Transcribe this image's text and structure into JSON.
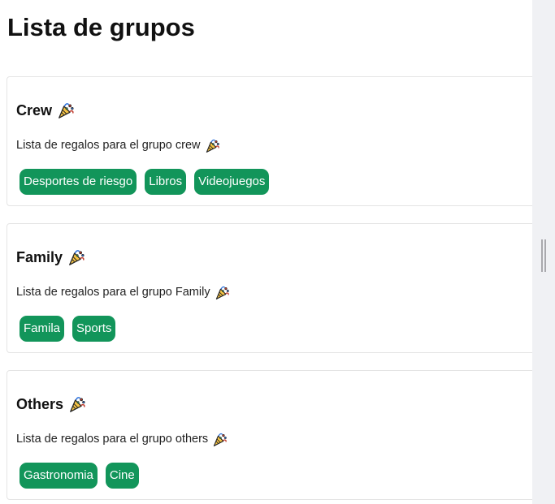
{
  "page": {
    "title": "Lista de grupos"
  },
  "groups": [
    {
      "name": "Crew",
      "description": "Lista de regalos para el grupo crew",
      "tags": [
        "Desportes de riesgo",
        "Libros",
        "Videojuegos"
      ]
    },
    {
      "name": "Family",
      "description": "Lista de regalos para el grupo Family",
      "tags": [
        "Famila",
        "Sports"
      ]
    },
    {
      "name": "Others",
      "description": "Lista de regalos para el grupo others",
      "tags": [
        "Gastronomia",
        "Cine"
      ]
    }
  ],
  "icons": {
    "title_emoji": "party-popper-icon",
    "description_emoji": "party-popper-icon",
    "scrollbar": "scrollbar-grip-icon"
  },
  "colors": {
    "tag_background": "#12955a",
    "tag_text": "#ffffff",
    "card_border": "#e4e4e4",
    "scrollbar_track": "#f0f1f4"
  }
}
